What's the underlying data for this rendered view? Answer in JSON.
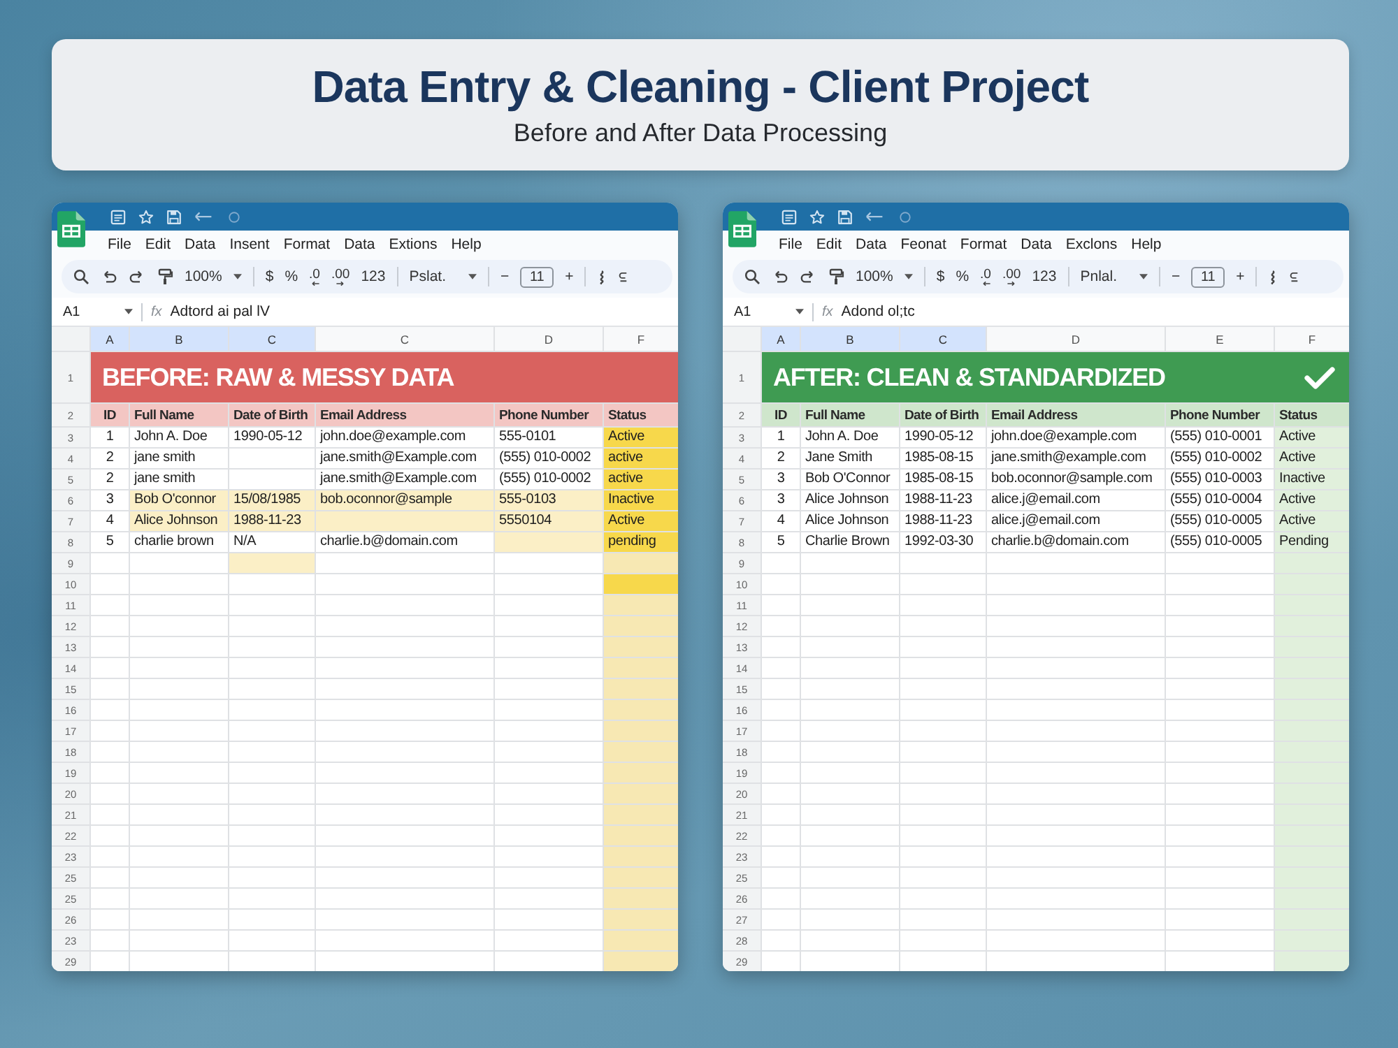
{
  "header": {
    "title": "Data Entry & Cleaning - Client Project",
    "subtitle": "Before and After Data Processing"
  },
  "sheets": [
    {
      "menu": [
        "File",
        "Edit",
        "Data",
        "Insent",
        "Format",
        "Data",
        "Extions",
        "Help"
      ],
      "toolbar": {
        "zoom": "100%",
        "currency": "$",
        "percent": "%",
        "decrease_decimals": ".0",
        "increase_decimals": ".00",
        "number_format": "123",
        "font": "Pslat.",
        "minus": "−",
        "font_size": "11",
        "plus": "+"
      },
      "formula_bar": {
        "cell": "A1",
        "function_label": "fx",
        "value": "Adtord ai pal lV"
      },
      "columns": [
        {
          "letter": "A",
          "selected": true,
          "heading": "ID"
        },
        {
          "letter": "B",
          "selected": true,
          "heading": "Full Name"
        },
        {
          "letter": "C",
          "selected": true,
          "heading": "Date of Birth"
        },
        {
          "letter": "C",
          "selected": false,
          "heading": "Email Address"
        },
        {
          "letter": "D",
          "selected": false,
          "heading": "Phone Number"
        },
        {
          "letter": "F",
          "selected": false,
          "heading": "Status",
          "color": "#f7e8b3"
        }
      ],
      "banner": {
        "row_number": "1",
        "text": "BEFORE: RAW & MESSY DATA",
        "color": "#d9625f",
        "done": false
      },
      "heading_row": {
        "number": "2",
        "color": "#f3c6c3"
      },
      "rows": [
        {
          "number": "3",
          "cells": [
            {
              "text": "1"
            },
            {
              "text": "John A. Doe"
            },
            {
              "text": "1990-05-12"
            },
            {
              "text": "john.doe@example.com"
            },
            {
              "text": "555-0101"
            },
            {
              "text": "Active",
              "color": "#f7d84b"
            }
          ]
        },
        {
          "number": "4",
          "cells": [
            {
              "text": "2"
            },
            {
              "text": "jane smith"
            },
            null,
            {
              "text": "jane.smith@Example.com"
            },
            {
              "text": "(555) 010-0002"
            },
            {
              "text": "active",
              "color": "#f7d84b"
            }
          ]
        },
        {
          "number": "5",
          "cells": [
            {
              "text": "2"
            },
            {
              "text": "jane smith"
            },
            null,
            {
              "text": "jane.smith@Example.com"
            },
            {
              "text": "(555) 010-0002"
            },
            {
              "text": "active",
              "color": "#f7d84b"
            }
          ]
        },
        {
          "number": "6",
          "cells": [
            {
              "text": "3"
            },
            {
              "text": "Bob O'connor",
              "color": "#fbefc6"
            },
            {
              "text": "15/08/1985",
              "color": "#fbefc6"
            },
            {
              "text": "bob.oconnor@sample",
              "color": "#fbefc6"
            },
            {
              "text": "555-0103",
              "color": "#fbefc6"
            },
            {
              "text": "Inactive",
              "color": "#f7d84b"
            }
          ]
        },
        {
          "number": "7",
          "cells": [
            {
              "text": "4"
            },
            {
              "text": "Alice Johnson",
              "color": "#fbefc6"
            },
            {
              "text": "1988-11-23",
              "color": "#fbefc6"
            },
            {
              "color": "#fbefc6"
            },
            {
              "text": "5550104",
              "color": "#fbefc6"
            },
            {
              "text": "Active",
              "color": "#f7d84b"
            }
          ]
        },
        {
          "number": "8",
          "cells": [
            {
              "text": "5"
            },
            {
              "text": "charlie brown"
            },
            {
              "text": "N/A"
            },
            {
              "text": "charlie.b@domain.com"
            },
            {
              "color": "#fbefc6"
            },
            {
              "text": "pending",
              "color": "#f7d84b"
            }
          ]
        },
        {
          "number": "9",
          "cells": [
            null,
            null,
            {
              "color": "#fbefc6"
            },
            null,
            null,
            null
          ]
        },
        {
          "number": "10",
          "cells": [
            null,
            null,
            null,
            null,
            null,
            {
              "color": "#f7d84b"
            }
          ]
        },
        {
          "number": "11"
        },
        {
          "number": "12"
        },
        {
          "number": "13"
        },
        {
          "number": "14"
        },
        {
          "number": "15"
        },
        {
          "number": "16"
        },
        {
          "number": "17"
        },
        {
          "number": "18"
        },
        {
          "number": "19"
        },
        {
          "number": "20"
        },
        {
          "number": "21"
        },
        {
          "number": "22"
        },
        {
          "number": "23"
        },
        {
          "number": "25"
        },
        {
          "number": "25"
        },
        {
          "number": "26"
        },
        {
          "number": "23"
        },
        {
          "number": "29"
        }
      ]
    },
    {
      "menu": [
        "File",
        "Edit",
        "Data",
        "Feonat",
        "Format",
        "Data",
        "Exclons",
        "Help"
      ],
      "toolbar": {
        "zoom": "100%",
        "currency": "$",
        "percent": "%",
        "decrease_decimals": ".0",
        "increase_decimals": ".00",
        "number_format": "123",
        "font": "Pnlal.",
        "minus": "−",
        "font_size": "11",
        "plus": "+"
      },
      "formula_bar": {
        "cell": "A1",
        "function_label": "fx",
        "value": "Adond ol;tc"
      },
      "columns": [
        {
          "letter": "A",
          "selected": true,
          "heading": "ID"
        },
        {
          "letter": "B",
          "selected": true,
          "heading": "Full Name"
        },
        {
          "letter": "C",
          "selected": true,
          "heading": "Date of Birth"
        },
        {
          "letter": "D",
          "selected": false,
          "heading": "Email Address"
        },
        {
          "letter": "E",
          "selected": false,
          "heading": "Phone Number"
        },
        {
          "letter": "F",
          "selected": false,
          "heading": "Status",
          "color": "#e1f0dc"
        }
      ],
      "banner": {
        "row_number": "1",
        "text": "AFTER: CLEAN & STANDARDIZED",
        "color": "#3f9b52",
        "done": true
      },
      "heading_row": {
        "number": "2",
        "color": "#cfe6cc"
      },
      "rows": [
        {
          "number": "3",
          "cells": [
            {
              "text": "1"
            },
            {
              "text": "John A. Doe"
            },
            {
              "text": "1990-05-12"
            },
            {
              "text": "john.doe@example.com"
            },
            {
              "text": "(555) 010-0001"
            },
            {
              "text": "Active"
            }
          ]
        },
        {
          "number": "4",
          "cells": [
            {
              "text": "2"
            },
            {
              "text": "Jane Smith"
            },
            {
              "text": "1985-08-15"
            },
            {
              "text": "jane.smith@example.com"
            },
            {
              "text": "(555) 010-0002"
            },
            {
              "text": "Active"
            }
          ]
        },
        {
          "number": "5",
          "cells": [
            {
              "text": "3"
            },
            {
              "text": "Bob O'Connor"
            },
            {
              "text": "1985-08-15"
            },
            {
              "text": "bob.oconnor@sample.com"
            },
            {
              "text": "(555) 010-0003"
            },
            {
              "text": "Inactive"
            }
          ]
        },
        {
          "number": "6",
          "cells": [
            {
              "text": "3"
            },
            {
              "text": "Alice Johnson"
            },
            {
              "text": "1988-11-23"
            },
            {
              "text": "alice.j@email.com"
            },
            {
              "text": "(555) 010-0004"
            },
            {
              "text": "Active"
            }
          ]
        },
        {
          "number": "7",
          "cells": [
            {
              "text": "4"
            },
            {
              "text": "Alice Johnson"
            },
            {
              "text": "1988-11-23"
            },
            {
              "text": "alice.j@email.com"
            },
            {
              "text": "(555) 010-0005"
            },
            {
              "text": "Active"
            }
          ]
        },
        {
          "number": "8",
          "cells": [
            {
              "text": "5"
            },
            {
              "text": "Charlie Brown"
            },
            {
              "text": "1992-03-30"
            },
            {
              "text": "charlie.b@domain.com"
            },
            {
              "text": "(555) 010-0005"
            },
            {
              "text": "Pending"
            }
          ]
        },
        {
          "number": "9"
        },
        {
          "number": "10"
        },
        {
          "number": "11"
        },
        {
          "number": "12"
        },
        {
          "number": "13"
        },
        {
          "number": "14"
        },
        {
          "number": "15"
        },
        {
          "number": "16"
        },
        {
          "number": "17"
        },
        {
          "number": "18"
        },
        {
          "number": "19"
        },
        {
          "number": "20"
        },
        {
          "number": "21"
        },
        {
          "number": "22"
        },
        {
          "number": "23"
        },
        {
          "number": "25"
        },
        {
          "number": "26"
        },
        {
          "number": "27"
        },
        {
          "number": "28"
        },
        {
          "number": "29"
        }
      ]
    }
  ]
}
